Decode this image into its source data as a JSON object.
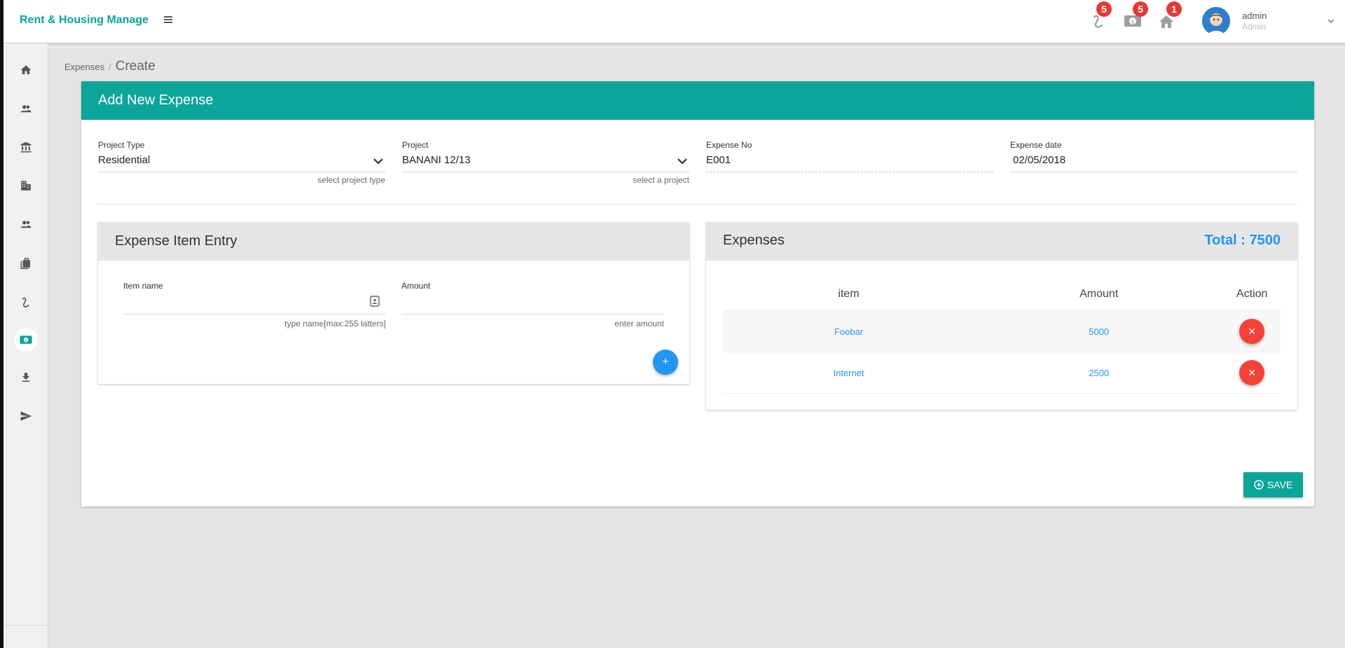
{
  "header": {
    "brand": "Rent & Housing Manage",
    "notifications": [
      {
        "icon": "rent-icon",
        "count": "5"
      },
      {
        "icon": "money-icon",
        "count": "5"
      },
      {
        "icon": "home-icon",
        "count": "1"
      }
    ],
    "user": {
      "name": "admin",
      "role": "Admin"
    }
  },
  "sidebar": {
    "items": [
      {
        "icon": "home-icon"
      },
      {
        "icon": "users-icon"
      },
      {
        "icon": "bank-icon"
      },
      {
        "icon": "building-icon"
      },
      {
        "icon": "tenants-icon"
      },
      {
        "icon": "briefcase-icon"
      },
      {
        "icon": "rent-icon"
      },
      {
        "icon": "money-icon",
        "active": true
      },
      {
        "icon": "download-icon"
      },
      {
        "icon": "send-icon"
      }
    ]
  },
  "breadcrumb": {
    "parent": "Expenses",
    "separator": "/",
    "current": "Create"
  },
  "form": {
    "title": "Add New Expense",
    "project_type": {
      "label": "Project Type",
      "value": "Residential",
      "hint": "select project type"
    },
    "project": {
      "label": "Project",
      "value": "BANANI 12/13",
      "hint": "select a project"
    },
    "expense_no": {
      "label": "Expense No",
      "value": "E001"
    },
    "expense_date": {
      "label": "Expense date",
      "value": "02/05/2018"
    }
  },
  "item_entry": {
    "title": "Expense Item Entry",
    "item_name": {
      "label": "Item name",
      "hint": "type name[max:255 latters]"
    },
    "amount": {
      "label": "Amount",
      "hint": "enter amount"
    },
    "add_label": "+"
  },
  "expenses": {
    "title": "Expenses",
    "total": "Total : 7500",
    "columns": [
      "item",
      "Amount",
      "Action"
    ],
    "rows": [
      {
        "item": "Foobar",
        "amount": "5000"
      },
      {
        "item": "Internet",
        "amount": "2500"
      }
    ],
    "delete_label": "✕"
  },
  "save_label": "SAVE",
  "colors": {
    "accent": "#0ca59a",
    "link": "#2196f3",
    "danger": "#f44336",
    "badge": "#e53935"
  }
}
